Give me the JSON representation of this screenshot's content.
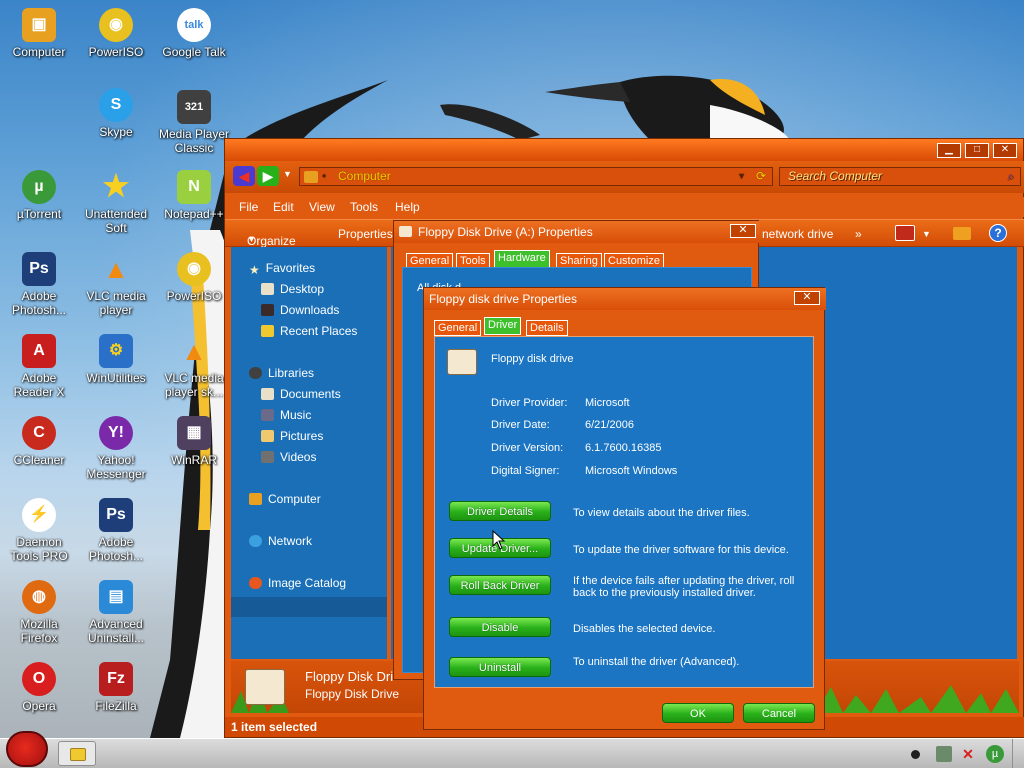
{
  "desktop": {
    "icons": [
      {
        "label": "Computer",
        "color": "#e8a020",
        "glyph": "▣"
      },
      {
        "label": "PowerISO",
        "color": "#e8c020",
        "glyph": "◉"
      },
      {
        "label": "Google Talk",
        "color": "#3a8ae0",
        "glyph": "talk"
      },
      {
        "label": "Skype",
        "color": "#2aa0e8",
        "glyph": "S"
      },
      {
        "label": "Media Player Classic",
        "color": "#404040",
        "glyph": "321"
      },
      {
        "label": "µTorrent",
        "color": "#3a9a3a",
        "glyph": "µ"
      },
      {
        "label": "Unattended Soft",
        "color": "#e8c020",
        "glyph": "★"
      },
      {
        "label": "Notepad++",
        "color": "#9ad040",
        "glyph": "N"
      },
      {
        "label": "Adobe Photosh...",
        "color": "#1e3e7a",
        "glyph": "Ps"
      },
      {
        "label": "VLC media player",
        "color": "#f08a10",
        "glyph": "▲"
      },
      {
        "label": "PowerISO",
        "color": "#e8c020",
        "glyph": "◉"
      },
      {
        "label": "Adobe Reader X",
        "color": "#c81e1e",
        "glyph": "A"
      },
      {
        "label": "WinUtilities",
        "color": "#e0b020",
        "glyph": "⚙"
      },
      {
        "label": "VLC media player sk...",
        "color": "#f08a10",
        "glyph": "▲"
      },
      {
        "label": "CCleaner",
        "color": "#c82a1e",
        "glyph": "C"
      },
      {
        "label": "Yahoo! Messenger",
        "color": "#7a2aa8",
        "glyph": "Y!"
      },
      {
        "label": "WinRAR",
        "color": "#504060",
        "glyph": "▦"
      },
      {
        "label": "Daemon Tools PRO",
        "color": "#e8581e",
        "glyph": "⚡"
      },
      {
        "label": "Adobe Photosh...",
        "color": "#1e3e7a",
        "glyph": "Ps"
      },
      {
        "label": "Mozilla Firefox",
        "color": "#e06a10",
        "glyph": "◍"
      },
      {
        "label": "Advanced Uninstall...",
        "color": "#2a8ad8",
        "glyph": "▤"
      },
      {
        "label": "Opera",
        "color": "#d81e1e",
        "glyph": "O"
      },
      {
        "label": "FileZilla",
        "color": "#b81e1e",
        "glyph": "Fz"
      }
    ]
  },
  "explorer": {
    "address": "Computer",
    "search_placeholder": "Search Computer",
    "menu": [
      "File",
      "Edit",
      "View",
      "Tools",
      "Help"
    ],
    "cmd_organize": "Organize",
    "cmd_properties": "Properties",
    "cmd_network_drive": "network drive",
    "nav": {
      "favorites": "Favorites",
      "desktop": "Desktop",
      "downloads": "Downloads",
      "recent": "Recent Places",
      "libraries": "Libraries",
      "documents": "Documents",
      "music": "Music",
      "pictures": "Pictures",
      "videos": "Videos",
      "computer": "Computer",
      "network": "Network",
      "image_catalog": "Image Catalog"
    },
    "details_name": "Floppy Disk Dri",
    "details_sub": "Floppy Disk Drive",
    "status": "1 item selected"
  },
  "dialog1": {
    "title": "Floppy Disk Drive (A:) Properties",
    "tabs": [
      "General",
      "Tools",
      "Hardware",
      "Sharing",
      "Customize"
    ],
    "selected_tab": "Hardware",
    "body_text": "All disk d"
  },
  "dialog2": {
    "title": "Floppy disk drive Properties",
    "tabs": [
      "General",
      "Driver",
      "Details"
    ],
    "selected_tab": "Driver",
    "device_name": "Floppy disk drive",
    "fields": [
      {
        "label": "Driver Provider:",
        "value": "Microsoft"
      },
      {
        "label": "Driver Date:",
        "value": "6/21/2006"
      },
      {
        "label": "Driver Version:",
        "value": "6.1.7600.16385"
      },
      {
        "label": "Digital Signer:",
        "value": "Microsoft Windows"
      }
    ],
    "actions": [
      {
        "button": "Driver Details",
        "desc": "To view details about the driver files."
      },
      {
        "button": "Update Driver...",
        "desc": "To update the driver software for this device."
      },
      {
        "button": "Roll Back Driver",
        "desc": "If the device fails after updating the driver, roll back to the previously installed driver."
      },
      {
        "button": "Disable",
        "desc": "Disables the selected device."
      },
      {
        "button": "Uninstall",
        "desc": "To uninstall the driver (Advanced)."
      }
    ],
    "ok": "OK",
    "cancel": "Cancel"
  },
  "colors": {
    "accent_orange": "#e05a10",
    "panel_blue": "#1b75c2",
    "button_green": "#28b01a"
  }
}
